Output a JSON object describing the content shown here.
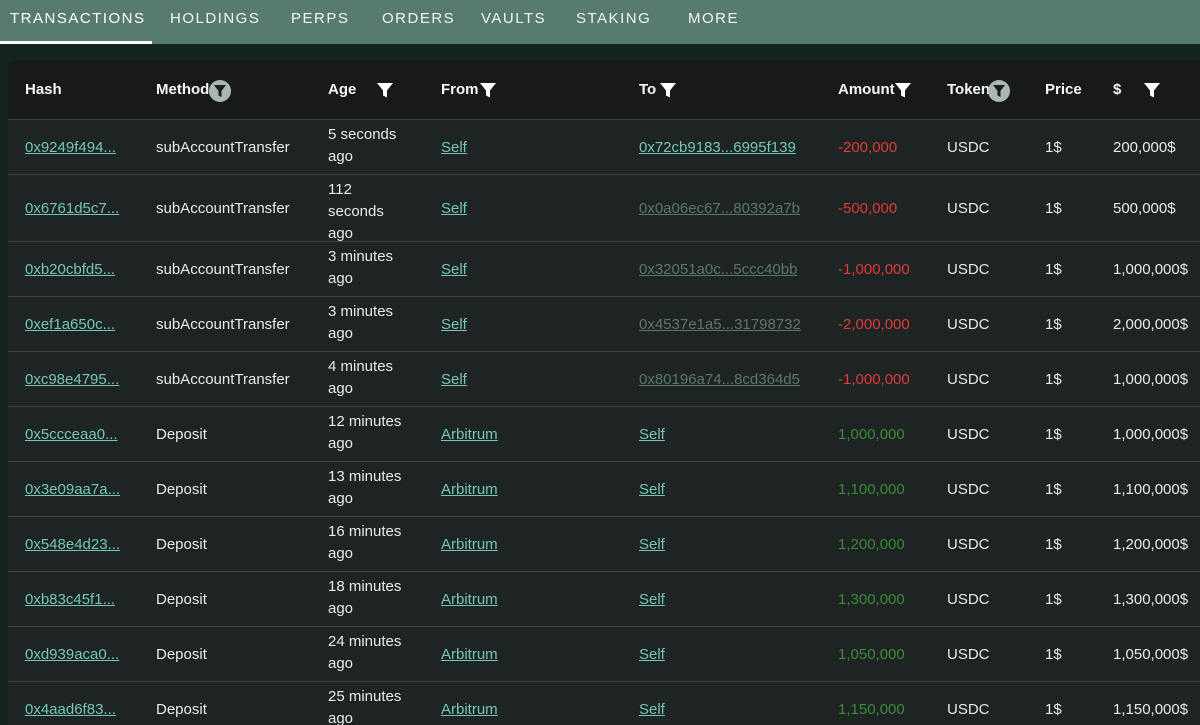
{
  "tabs": [
    {
      "label": "TRANSACTIONS",
      "active": true
    },
    {
      "label": "HOLDINGS"
    },
    {
      "label": "PERPS"
    },
    {
      "label": "ORDERS"
    },
    {
      "label": "VAULTS"
    },
    {
      "label": "STAKING"
    },
    {
      "label": "MORE"
    }
  ],
  "table": {
    "headers": {
      "hash": "Hash",
      "method": "Method",
      "age": "Age",
      "from": "From",
      "to": "To",
      "amount": "Amount",
      "token": "Token",
      "price": "Price",
      "usd": "$"
    },
    "rows": [
      {
        "hash": "0x9249f494...",
        "method": "subAccountTransfer",
        "age": "5 seconds ago",
        "from": "Self",
        "to": "0x72cb9183...6995f139",
        "to_dim": false,
        "amount": "-200,000",
        "amount_sign": "negative",
        "token": "USDC",
        "price": "1$",
        "usd": "200,000$"
      },
      {
        "hash": "0x6761d5c7...",
        "method": "subAccountTransfer",
        "age": "112 seconds ago",
        "from": "Self",
        "to": "0x0a06ec67...80392a7b",
        "to_dim": true,
        "amount": "-500,000",
        "amount_sign": "negative",
        "token": "USDC",
        "price": "1$",
        "usd": "500,000$"
      },
      {
        "hash": "0xb20cbfd5...",
        "method": "subAccountTransfer",
        "age": "3 minutes ago",
        "from": "Self",
        "to": "0x32051a0c...5ccc40bb",
        "to_dim": true,
        "amount": "-1,000,000",
        "amount_sign": "negative",
        "token": "USDC",
        "price": "1$",
        "usd": "1,000,000$"
      },
      {
        "hash": "0xef1a650c...",
        "method": "subAccountTransfer",
        "age": "3 minutes ago",
        "from": "Self",
        "to": "0x4537e1a5...31798732",
        "to_dim": true,
        "amount": "-2,000,000",
        "amount_sign": "negative",
        "token": "USDC",
        "price": "1$",
        "usd": "2,000,000$"
      },
      {
        "hash": "0xc98e4795...",
        "method": "subAccountTransfer",
        "age": "4 minutes ago",
        "from": "Self",
        "to": "0x80196a74...8cd364d5",
        "to_dim": true,
        "amount": "-1,000,000",
        "amount_sign": "negative",
        "token": "USDC",
        "price": "1$",
        "usd": "1,000,000$"
      },
      {
        "hash": "0x5ccceaa0...",
        "method": "Deposit",
        "age": "12 minutes ago",
        "from": "Arbitrum",
        "to": "Self",
        "to_dim": false,
        "amount": "1,000,000",
        "amount_sign": "positive",
        "token": "USDC",
        "price": "1$",
        "usd": "1,000,000$"
      },
      {
        "hash": "0x3e09aa7a...",
        "method": "Deposit",
        "age": "13 minutes ago",
        "from": "Arbitrum",
        "to": "Self",
        "to_dim": false,
        "amount": "1,100,000",
        "amount_sign": "positive",
        "token": "USDC",
        "price": "1$",
        "usd": "1,100,000$"
      },
      {
        "hash": "0x548e4d23...",
        "method": "Deposit",
        "age": "16 minutes ago",
        "from": "Arbitrum",
        "to": "Self",
        "to_dim": false,
        "amount": "1,200,000",
        "amount_sign": "positive",
        "token": "USDC",
        "price": "1$",
        "usd": "1,200,000$"
      },
      {
        "hash": "0xb83c45f1...",
        "method": "Deposit",
        "age": "18 minutes ago",
        "from": "Arbitrum",
        "to": "Self",
        "to_dim": false,
        "amount": "1,300,000",
        "amount_sign": "positive",
        "token": "USDC",
        "price": "1$",
        "usd": "1,300,000$"
      },
      {
        "hash": "0xd939aca0...",
        "method": "Deposit",
        "age": "24 minutes ago",
        "from": "Arbitrum",
        "to": "Self",
        "to_dim": false,
        "amount": "1,050,000",
        "amount_sign": "positive",
        "token": "USDC",
        "price": "1$",
        "usd": "1,050,000$"
      },
      {
        "hash": "0x4aad6f83...",
        "method": "Deposit",
        "age": "25 minutes ago",
        "from": "Arbitrum",
        "to": "Self",
        "to_dim": false,
        "amount": "1,150,000",
        "amount_sign": "positive",
        "token": "USDC",
        "price": "1$",
        "usd": "1,150,000$"
      }
    ]
  },
  "icons": {
    "filter": "filter-funnel-icon"
  },
  "colors": {
    "tab_bar": "#577a71",
    "link": "#74c7b6",
    "negative": "#e03a3a",
    "positive": "#3d8a3a"
  }
}
